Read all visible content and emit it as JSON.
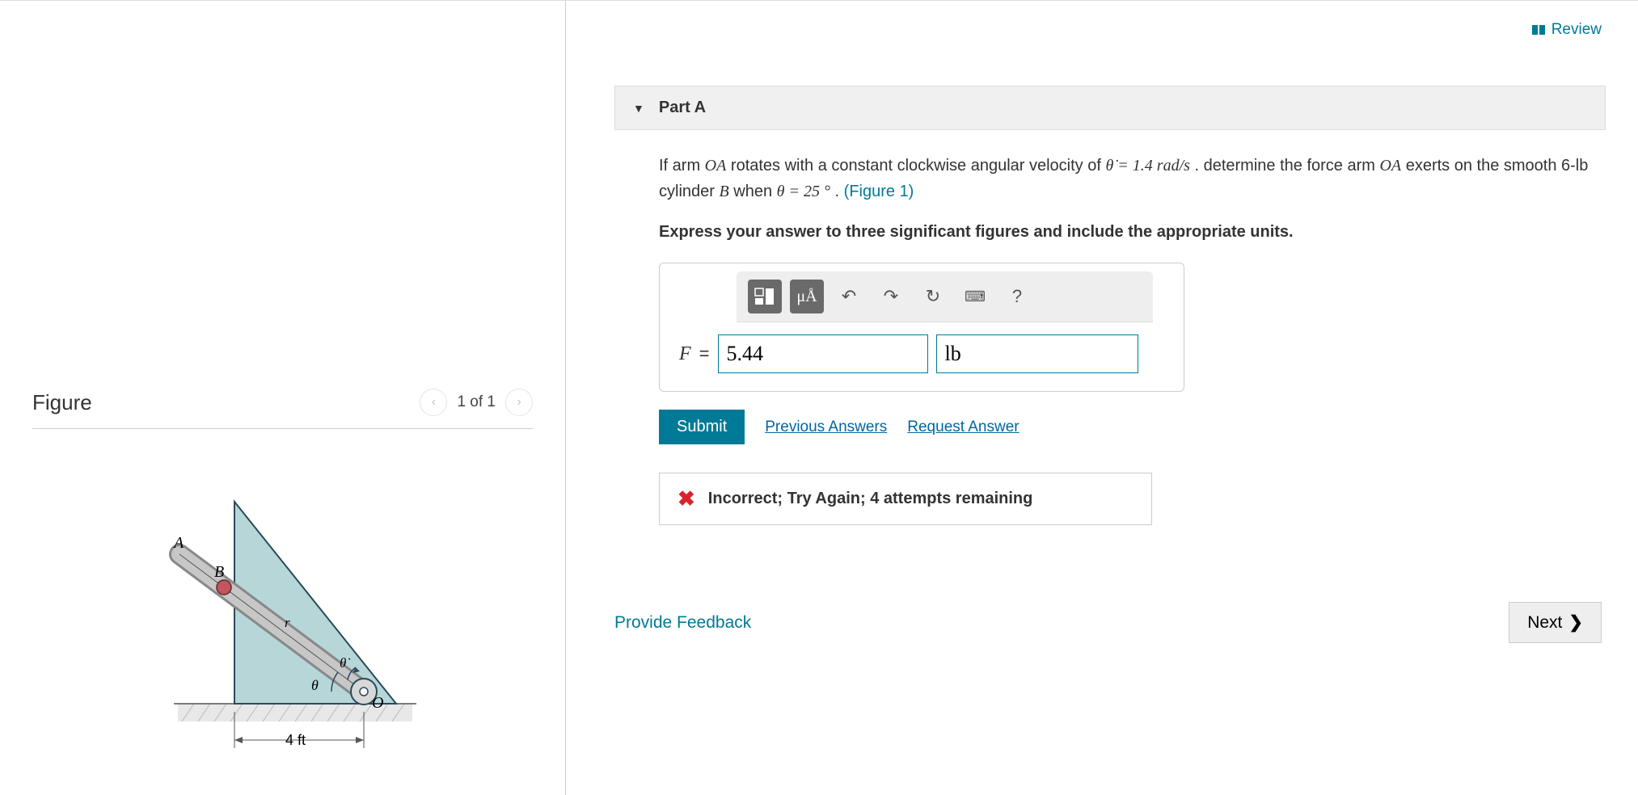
{
  "header": {
    "review_label": "Review"
  },
  "figure": {
    "title": "Figure",
    "counter": "1 of 1",
    "labels": {
      "A": "A",
      "B": "B",
      "O": "O",
      "r": "r",
      "theta": "θ",
      "thetadot": "θ̇",
      "dim": "4 ft"
    }
  },
  "part": {
    "title": "Part A",
    "text_prefix": "If arm ",
    "OA": "OA",
    "text_mid1": " rotates with a constant clockwise angular velocity of ",
    "thetadot_eq": "θ̇ = 1.4 rad/s",
    "text_mid2": " . determine the force arm ",
    "text_mid3": " exerts on the smooth 6-lb cylinder ",
    "B": "B",
    "text_mid4": " when ",
    "theta_eq": "θ = 25 °",
    "text_end": ". ",
    "figref": "(Figure 1)",
    "instruction": "Express your answer to three significant figures and include the appropriate units."
  },
  "toolbar": {
    "units_btn": "μÅ",
    "help_btn": "?"
  },
  "answer": {
    "label": "F",
    "equals": "=",
    "value": "5.44",
    "unit": "lb"
  },
  "actions": {
    "submit": "Submit",
    "previous_answers": "Previous Answers",
    "request_answer": "Request Answer"
  },
  "feedback": {
    "text": "Incorrect; Try Again; 4 attempts remaining"
  },
  "footer": {
    "provide_feedback": "Provide Feedback",
    "next": "Next"
  }
}
